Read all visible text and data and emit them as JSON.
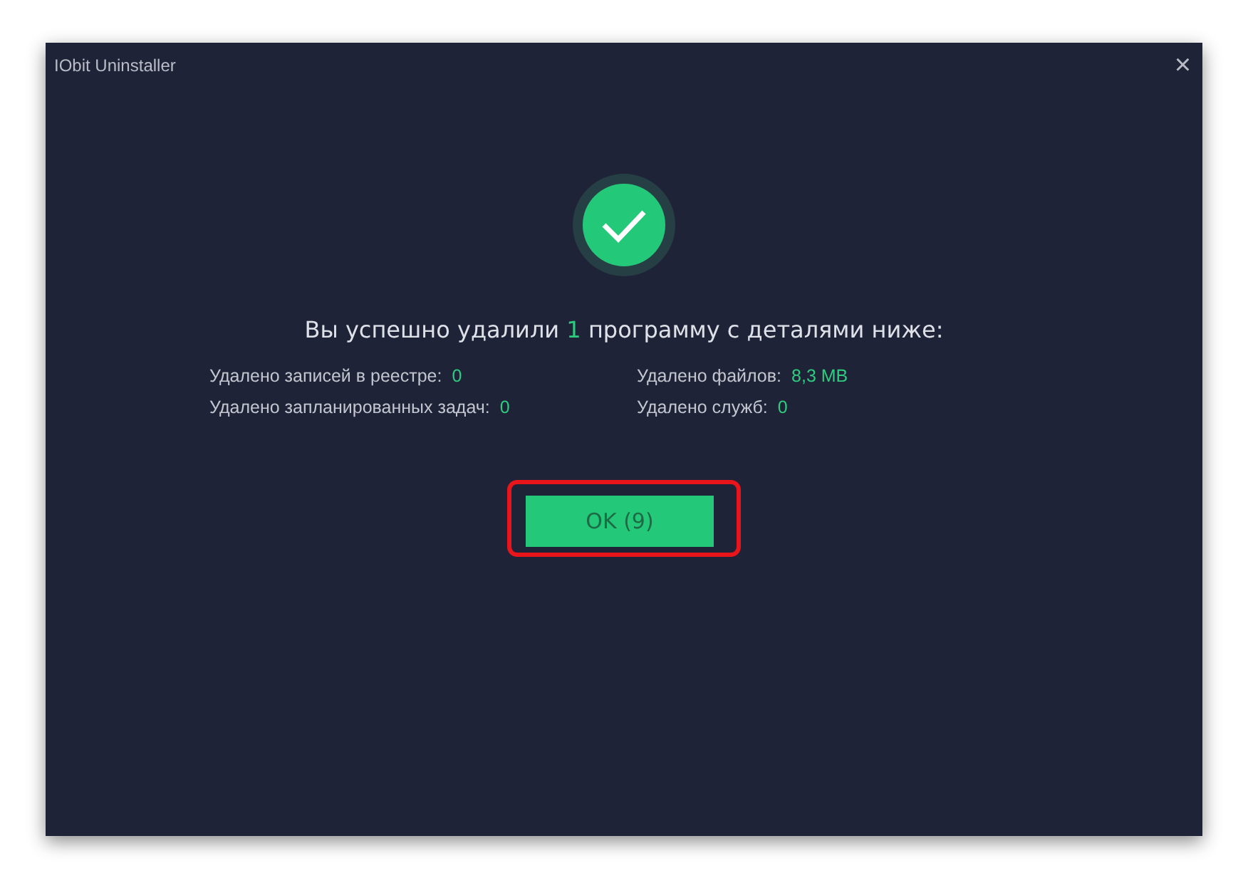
{
  "window": {
    "title": "IObit Uninstaller",
    "close": "×"
  },
  "status": {
    "kind": "success"
  },
  "message": {
    "before": "Вы успешно удалили ",
    "count": "1",
    "after": " программу с деталями ниже:"
  },
  "stats": [
    {
      "label": "Удалено записей в реестре:",
      "value": "0"
    },
    {
      "label": "Удалено файлов:",
      "value": "8,3 MB"
    },
    {
      "label": "Удалено запланированных задач:",
      "value": "0"
    },
    {
      "label": "Удалено служб:",
      "value": "0"
    }
  ],
  "button": {
    "label": "OK (9)",
    "highlighted": true
  }
}
